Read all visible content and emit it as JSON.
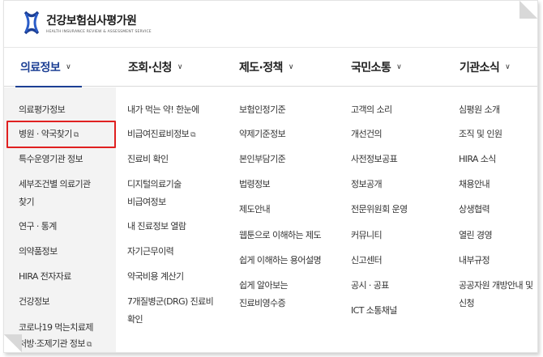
{
  "header": {
    "org_name": "건강보험심사평가원",
    "org_sub": "HEALTH INSURANCE REVIEW & ASSESSMENT SERVICE"
  },
  "nav": [
    {
      "label": "의료정보",
      "active": true
    },
    {
      "label": "조회·신청",
      "active": false
    },
    {
      "label": "제도·정책",
      "active": false
    },
    {
      "label": "국민소통",
      "active": false
    },
    {
      "label": "기관소식",
      "active": false
    }
  ],
  "columns": {
    "medical_info": [
      "의료평가정보",
      "병원 · 약국찾기",
      "특수운영기관 정보",
      "세부조건별 의료기관",
      "찾기",
      "연구 · 통계",
      "의약품정보",
      "HIRA 전자자료",
      "건강정보",
      "코로나19 먹는치료제",
      "처방·조제기관 정보"
    ],
    "inquiry": [
      "내가 먹는 약! 한눈에",
      "비급여진료비정보",
      "진료비 확인",
      "디지털의료기술",
      "비급여정보",
      "내 진료정보 열람",
      "자기근무이력",
      "약국비용 계산기",
      "7개질병군(DRG) 진료비",
      "확인"
    ],
    "policy": [
      "보험인정기준",
      "약제기준정보",
      "본인부담기준",
      "법령정보",
      "제도안내",
      "웹툰으로 이해하는 제도",
      "쉽게 이해하는 용어설명",
      "쉽게 알아보는",
      "진료비영수증"
    ],
    "communication": [
      "고객의 소리",
      "개선건의",
      "사전정보공표",
      "정보공개",
      "전문위원회 운영",
      "커뮤니티",
      "신고센터",
      "공시 · 공표",
      "ICT 소통채널"
    ],
    "agency": [
      "심평원 소개",
      "조직 및 인원",
      "HIRA 소식",
      "채용안내",
      "상생협력",
      "열린 경영",
      "내부규정",
      "공공자원 개방안내 및",
      "신청"
    ]
  },
  "icons": {
    "external": "external-window-icon",
    "chevron": "chevron-down-icon"
  },
  "colors": {
    "accent": "#1c3f94",
    "highlight": "#e02020",
    "first_column_bg": "#f3f3f3"
  }
}
